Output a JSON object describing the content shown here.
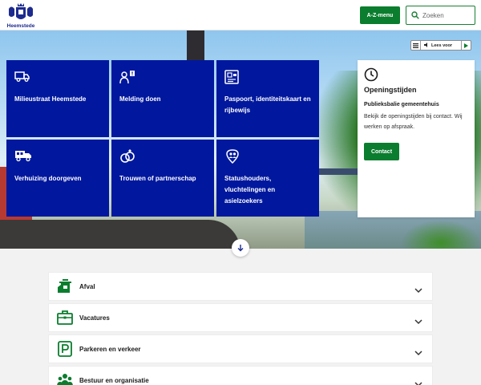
{
  "header": {
    "logo_text": "Heemstede",
    "az_menu_label": "A-Z-menu",
    "search_placeholder": "Zoeken"
  },
  "readaloud": {
    "label": "Lees voor"
  },
  "tiles": [
    {
      "label": "Milieustraat Heemstede",
      "icon": "truck-icon"
    },
    {
      "label": "Melding doen",
      "icon": "person-notification-icon"
    },
    {
      "label": "Paspoort, identiteitskaart en rijbewijs",
      "icon": "id-card-icon"
    },
    {
      "label": "Verhuizing doorgeven",
      "icon": "moving-truck-icon"
    },
    {
      "label": "Trouwen of partnerschap",
      "icon": "rings-icon"
    },
    {
      "label": "Statushouders, vluchtelingen en asielzoekers",
      "icon": "location-people-icon"
    }
  ],
  "hours": {
    "title": "Openingstijden",
    "subtitle": "Publieksbalie gemeentehuis",
    "text": "Bekijk de openingstijden bij contact. Wij werken op afspraak.",
    "button": "Contact"
  },
  "accordion": [
    {
      "label": "Afval",
      "icon": "waste-icon"
    },
    {
      "label": "Vacatures",
      "icon": "briefcase-icon"
    },
    {
      "label": "Parkeren en verkeer",
      "icon": "parking-icon"
    },
    {
      "label": "Bestuur en organisatie",
      "icon": "people-group-icon"
    }
  ],
  "colors": {
    "tile_blue": "#00179e",
    "green": "#0b7d2e"
  }
}
